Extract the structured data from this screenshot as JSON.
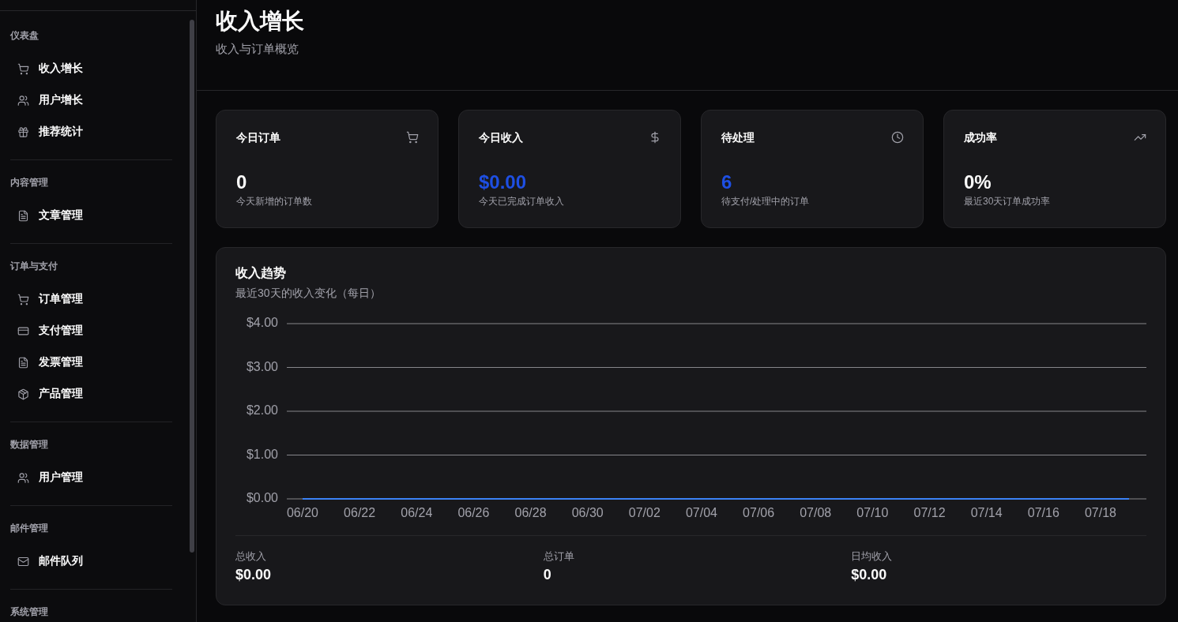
{
  "sidebar": {
    "sections": [
      {
        "title": "仪表盘",
        "items": [
          {
            "label": "收入增长"
          },
          {
            "label": "用户增长"
          },
          {
            "label": "推荐统计"
          }
        ]
      },
      {
        "title": "内容管理",
        "items": [
          {
            "label": "文章管理"
          }
        ]
      },
      {
        "title": "订单与支付",
        "items": [
          {
            "label": "订单管理"
          },
          {
            "label": "支付管理"
          },
          {
            "label": "发票管理"
          },
          {
            "label": "产品管理"
          }
        ]
      },
      {
        "title": "数据管理",
        "items": [
          {
            "label": "用户管理"
          }
        ]
      },
      {
        "title": "邮件管理",
        "items": [
          {
            "label": "邮件队列"
          }
        ]
      },
      {
        "title": "系统管理"
      }
    ]
  },
  "header": {
    "title": "收入增长",
    "subtitle": "收入与订单概览"
  },
  "stat_cards": [
    {
      "title": "今日订单",
      "value": "0",
      "description": "今天新增的订单数",
      "color": "#fafafa"
    },
    {
      "title": "今日收入",
      "value": "$0.00",
      "description": "今天已完成订单收入",
      "color": "#1e4fe3"
    },
    {
      "title": "待处理",
      "value": "6",
      "description": "待支付/处理中的订单",
      "color": "#1e4fe3"
    },
    {
      "title": "成功率",
      "value": "0%",
      "description": "最近30天订单成功率",
      "color": "#fafafa"
    }
  ],
  "revenue_chart": {
    "title": "收入趋势",
    "subtitle": "最近30天的收入变化（每日）",
    "chart_data": {
      "type": "line",
      "categories": [
        "06/20",
        null,
        "06/22",
        null,
        "06/24",
        null,
        "06/26",
        null,
        "06/28",
        null,
        "06/30",
        null,
        "07/02",
        null,
        "07/04",
        null,
        "07/06",
        null,
        "07/08",
        null,
        "07/10",
        null,
        "07/12",
        null,
        "07/14",
        null,
        "07/16",
        null,
        "07/18",
        null
      ],
      "series": [
        {
          "color": "#3b82f6",
          "values": [
            0,
            0,
            0,
            0,
            0,
            0,
            0,
            0,
            0,
            0,
            0,
            0,
            0,
            0,
            0,
            0,
            0,
            0,
            0,
            0,
            0,
            0,
            0,
            0,
            0,
            0,
            0,
            0,
            0,
            0
          ]
        }
      ],
      "ylim": [
        0,
        4
      ],
      "yticks": [
        {
          "value": 0,
          "label": "$0.00"
        },
        {
          "value": 1,
          "label": "$1.00"
        },
        {
          "value": 2,
          "label": "$2.00"
        },
        {
          "value": 3,
          "label": "$3.00"
        },
        {
          "value": 4,
          "label": "$4.00"
        }
      ],
      "grid": true
    },
    "summary": [
      {
        "label": "总收入",
        "value": "$0.00"
      },
      {
        "label": "总订单",
        "value": "0"
      },
      {
        "label": "日均收入",
        "value": "$0.00"
      }
    ]
  }
}
